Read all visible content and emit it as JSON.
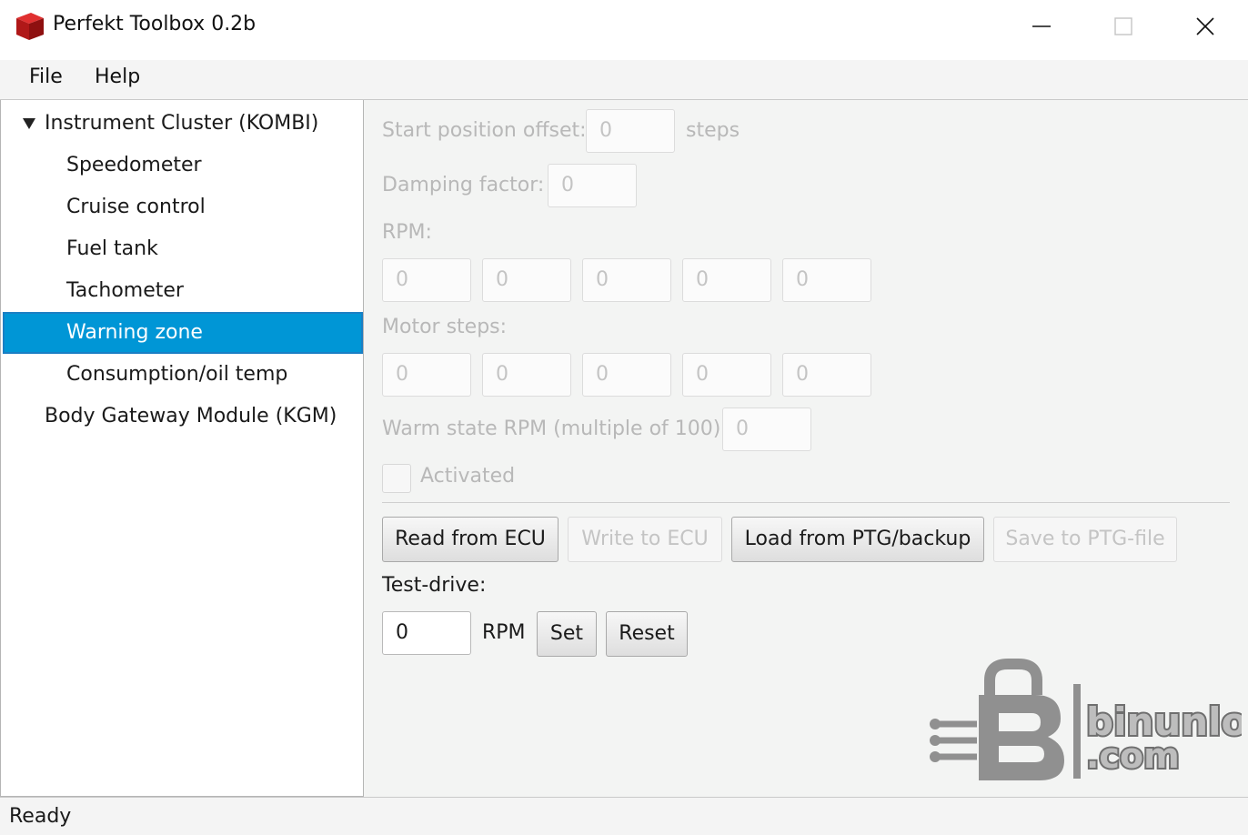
{
  "window": {
    "title": "Perfekt Toolbox 0.2b",
    "icon": "red-cube-icon",
    "controls": [
      "minimize-icon",
      "maximize-icon",
      "close-icon"
    ]
  },
  "menu": {
    "file": "File",
    "help": "Help"
  },
  "tree": {
    "root": "Instrument Cluster (KOMBI)",
    "children": [
      "Speedometer",
      "Cruise control",
      "Fuel tank",
      "Tachometer",
      "Warning zone",
      "Consumption/oil temp"
    ],
    "selected": "Warning zone",
    "second_root": "Body Gateway Module (KGM)"
  },
  "form": {
    "start_offset_label": "Start position offset:",
    "start_offset_value": "0",
    "start_offset_unit": "steps",
    "damping_label": "Damping factor:",
    "damping_value": "0",
    "rpm_label": "RPM:",
    "rpm_values": [
      "0",
      "0",
      "0",
      "0",
      "0"
    ],
    "motor_steps_label": "Motor steps:",
    "motor_steps_values": [
      "0",
      "0",
      "0",
      "0",
      "0"
    ],
    "warm_rpm_label": "Warm state RPM (multiple of 100):",
    "warm_rpm_value": "0",
    "activated_label": "Activated",
    "activated_checked": false
  },
  "buttons": {
    "read": "Read from ECU",
    "write": "Write to ECU",
    "load": "Load from PTG/backup",
    "save": "Save to PTG-file"
  },
  "test_drive": {
    "label": "Test-drive:",
    "value": "0",
    "unit": "RPM",
    "set": "Set",
    "reset": "Reset"
  },
  "watermark": {
    "line1": "binunlock",
    "line2": ".com"
  },
  "status": "Ready"
}
